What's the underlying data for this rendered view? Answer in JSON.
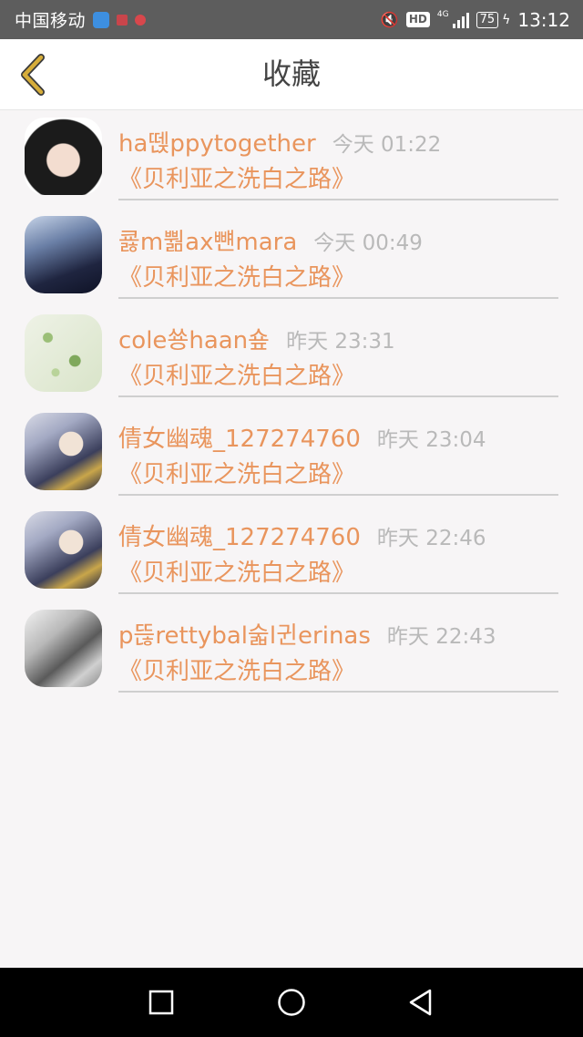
{
  "status_bar": {
    "carrier": "中国移动",
    "hd": "HD",
    "network": "4G",
    "battery": "75",
    "time": "13:12"
  },
  "header": {
    "title": "收藏"
  },
  "colors": {
    "accent": "#e9955d",
    "back_arrow": "#d6ad3a",
    "timestamp": "#b9b9b9"
  },
  "favorites": [
    {
      "name": "ha뗁ppytogether",
      "time": "今天 01:22",
      "book": "《贝利亚之洗白之路》"
    },
    {
      "name": "쿓m뿲ax뺸mara",
      "time": "今天 00:49",
      "book": "《贝利亚之洗白之路》"
    },
    {
      "name": "cole쑝haan숖",
      "time": "昨天 23:31",
      "book": "《贝利亚之洗白之路》"
    },
    {
      "name": "倩女幽魂_127274760",
      "time": "昨天 23:04",
      "book": "《贝利亚之洗白之路》"
    },
    {
      "name": "倩女幽魂_127274760",
      "time": "昨天 22:46",
      "book": "《贝利亚之洗白之路》"
    },
    {
      "name": "p뜮rettybal숣l귄erinas",
      "time": "昨天 22:43",
      "book": "《贝利亚之洗白之路》"
    }
  ]
}
